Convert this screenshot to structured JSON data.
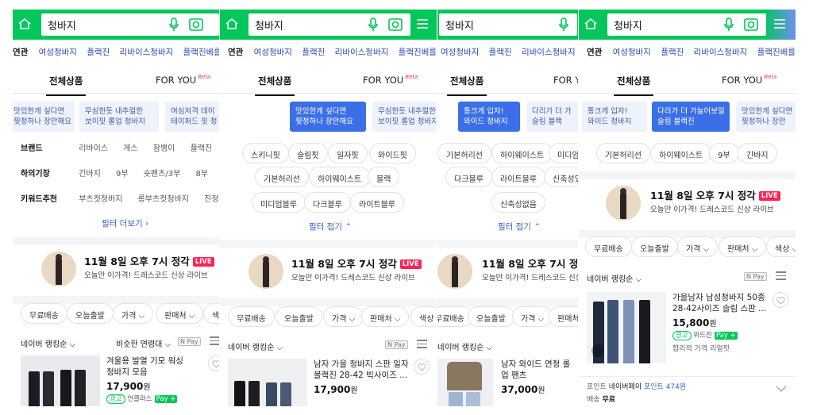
{
  "query": "청바지",
  "related": {
    "label": "연관",
    "items": [
      "여성청바지",
      "플랙진",
      "리바이스청바지",
      "플랙진베를린"
    ],
    "p3_items": [
      "여성청바지",
      "플랙진",
      "리바이스청바지",
      "플"
    ]
  },
  "tabs": {
    "all": "전체상품",
    "foryou": "FOR YOU",
    "beta": "Beta"
  },
  "p1": {
    "banners": [
      {
        "l1": "맛있한게 싶다면",
        "l2": "찢청하나 장만해요"
      },
      {
        "l1": "무심한듯 내추럴한",
        "l2": "보이핏 롤업 청바지"
      },
      {
        "l1": "여심저격 데이",
        "l2": "테이퍼드 핏 청"
      },
      {
        "l1": "이가 더 가늘어보일",
        "l2": "림 블랙진"
      }
    ],
    "filters": [
      {
        "key": "브랜드",
        "values": [
          "리바이스",
          "게스",
          "잠뱅이",
          "플랙진",
          "c"
        ]
      },
      {
        "key": "하의기장",
        "values": [
          "긴바지",
          "9부",
          "숏팬츠/3부",
          "8부",
          "7"
        ]
      },
      {
        "key": "키워드추천",
        "values": [
          "부츠컷청바지",
          "롱부츠컷청바지",
          "진청바지"
        ]
      }
    ],
    "more": "필터 더보기 ›",
    "live": {
      "title": "11월 8일 오후 7시 정각",
      "badge": "LIVE",
      "sub": "오늘만 이가격! 드레스코드 신상 라이브"
    },
    "chips": [
      "무료배송",
      "오늘출발",
      "가격 ⌵",
      "판매처 ⌵",
      "색상"
    ],
    "sort": "네이버 랭킹순 ⌵",
    "sort2": "비슷한 연령대 ⌵",
    "npay": "N Pay",
    "product": {
      "name": "겨울용 발열 기모 워싱 청바지 모음",
      "price": "17,900",
      "won": "원",
      "ad": "광고",
      "seller": "언클라스",
      "pay": "Pay +"
    }
  },
  "p2": {
    "banners": [
      {
        "l1": "맛있한게 싶다면",
        "l2": "찢청하나 장만해요"
      },
      {
        "l1": "무심한듯 내추럴한",
        "l2": "보이핏 롤업 청바지"
      }
    ],
    "chips": [
      "스키니핏",
      "슬림핏",
      "일자핏",
      "와이드핏",
      "기본허리선",
      "하이웨이스트",
      "블랙",
      "미디엄블루",
      "다크블루",
      "라이트블루"
    ],
    "fold": "필터 접기 ⌃",
    "live": {
      "title": "11월 8일 오후 7시 정각",
      "badge": "LIVE",
      "sub": "오늘만 이가격! 드레스코드 신상 라이브"
    },
    "sortchips": [
      "무료배송",
      "오늘출발",
      "가격 ⌵",
      "판매처 ⌵",
      "색상"
    ],
    "sort": "네이버 랭킹순 ⌵",
    "npay": "N Pay",
    "product": {
      "name": "남자 가을 청바지 스판 일자 블랙진 28-42 빅사이즈 ...",
      "price": "17,900",
      "won": "원"
    }
  },
  "p3": {
    "banners": [
      {
        "l1": "통크게 입자!",
        "l2": "와이드 청바지"
      },
      {
        "l1": "다리가 더 가",
        "l2": "슬림 블랙"
      }
    ],
    "chips": [
      "기본허리선",
      "하이웨이스트",
      "미디엄",
      "다크블루",
      "라이트블루",
      "신축성있",
      "신축성없음"
    ],
    "fold": "필터 접기 ⌃",
    "live": {
      "title": "11월 8일 오후 7시 정각",
      "badge": "L",
      "sub": "오늘만 이가격! 드레스코드 신상 라이브"
    },
    "sortchips": [
      "무료배송",
      "오늘출발",
      "가격 ⌵",
      "판매처"
    ],
    "sort": "네이버 랭킹순 ⌵",
    "product": {
      "name": "남자 와이드 연청 롤업 팬츠",
      "price": "37,000",
      "won": "원"
    }
  },
  "p4": {
    "banners": [
      {
        "l1": "통크게 입자!",
        "l2": "와이드 청바지"
      },
      {
        "l1": "다리가 더 가늘어보일",
        "l2": "슬림 블랙진"
      },
      {
        "l1": "맛있한게 싶다면",
        "l2": "찢청하나 장만"
      }
    ],
    "chips": [
      "기본허리선",
      "하이웨이스트",
      "9부",
      "긴바지"
    ],
    "live": {
      "title": "11월 8일 오후 7시 정각",
      "badge": "LIVE",
      "sub": "오늘만 이가격! 드레스코드 신상 라이브"
    },
    "sortchips": [
      "무료배송",
      "오늘출발",
      "가격 ⌵",
      "판매처 ⌵",
      "색상 ⌵"
    ],
    "sort": "네이버 랭킹순 ⌵",
    "npay": "N Pay",
    "product": {
      "name": "가을남자 남성청바지 50종 28-42사이즈 슬림 스판 ...",
      "price": "15,800",
      "won": "원",
      "ad": "광고",
      "seller": "위드진",
      "pay": "Pay +",
      "tag": "합리적 가격 리얼핏"
    },
    "point_label": "포인트",
    "point_text": "네이버페이",
    "point_value": "포인트 474원",
    "ship_label": "배송",
    "ship_value": "무료"
  },
  "colors": {
    "green": "#03c75a",
    "blue": "#3b6fe8",
    "live": "#ff2255"
  }
}
